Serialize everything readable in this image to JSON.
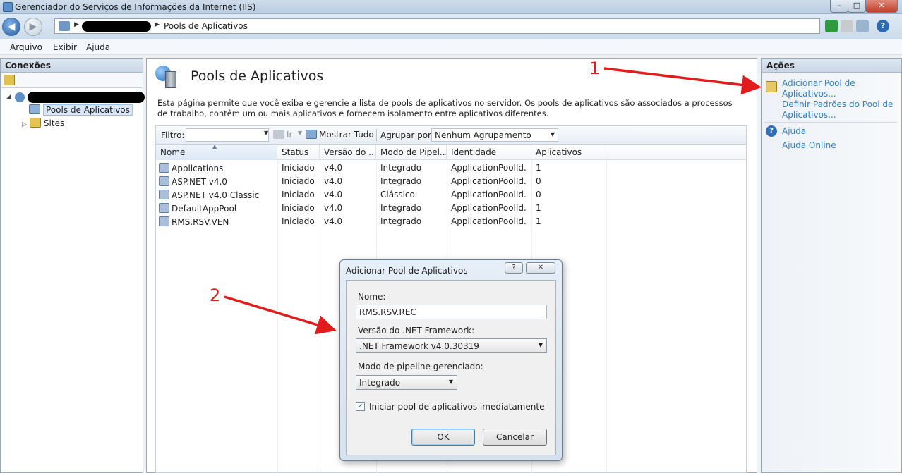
{
  "window": {
    "title": "Gerenciador do Serviços de Informações da Internet (IIS)"
  },
  "address": {
    "current": "Pools de Aplicativos"
  },
  "menu": {
    "file": "Arquivo",
    "view": "Exibir",
    "help": "Ajuda"
  },
  "connections": {
    "title": "Conexões",
    "tree": {
      "pools": "Pools de Aplicativos",
      "sites": "Sites"
    }
  },
  "main": {
    "title": "Pools de Aplicativos",
    "description": "Esta página permite que você exiba e gerencie a lista de pools de aplicativos no servidor. Os pools de aplicativos são associados a processos de trabalho, contêm um ou mais aplicativos e fornecem isolamento entre aplicativos diferentes.",
    "filter": {
      "label": "Filtro:",
      "go": "Ir",
      "show_all": "Mostrar Tudo",
      "group_by_label": "Agrupar por:",
      "group_by_value": "Nenhum Agrupamento"
    },
    "columns": [
      "Nome",
      "Status",
      "Versão do ...",
      "Modo de Pipel...",
      "Identidade",
      "Aplicativos"
    ],
    "rows": [
      [
        "Applications",
        "Iniciado",
        "v4.0",
        "Integrado",
        "ApplicationPoolId...",
        "1"
      ],
      [
        "ASP.NET v4.0",
        "Iniciado",
        "v4.0",
        "Integrado",
        "ApplicationPoolId...",
        "0"
      ],
      [
        "ASP.NET v4.0 Classic",
        "Iniciado",
        "v4.0",
        "Clássico",
        "ApplicationPoolId...",
        "0"
      ],
      [
        "DefaultAppPool",
        "Iniciado",
        "v4.0",
        "Integrado",
        "ApplicationPoolId...",
        "1"
      ],
      [
        "RMS.RSV.VEN",
        "Iniciado",
        "v4.0",
        "Integrado",
        "ApplicationPoolId...",
        "1"
      ]
    ]
  },
  "actions": {
    "title": "Ações",
    "add_pool": "Adicionar Pool de Aplicativos...",
    "set_defaults": "Definir Padrões do Pool de Aplicativos...",
    "help": "Ajuda",
    "help_online": "Ajuda Online"
  },
  "annotations": {
    "one": "1",
    "two": "2"
  },
  "dialog": {
    "title": "Adicionar Pool de Aplicativos",
    "help_glyph": "?",
    "close_glyph": "✕",
    "name_label": "Nome:",
    "name_value": "RMS.RSV.REC",
    "version_label": "Versão do .NET Framework:",
    "version_value": ".NET Framework v4.0.30319",
    "pipeline_label": "Modo de pipeline gerenciado:",
    "pipeline_value": "Integrado",
    "start_checkbox_label": "Iniciar pool de aplicativos imediatamente",
    "start_checked": true,
    "ok": "OK",
    "cancel": "Cancelar"
  },
  "colors": {
    "link": "#2d7fc9",
    "annotation": "#e11c1c"
  }
}
